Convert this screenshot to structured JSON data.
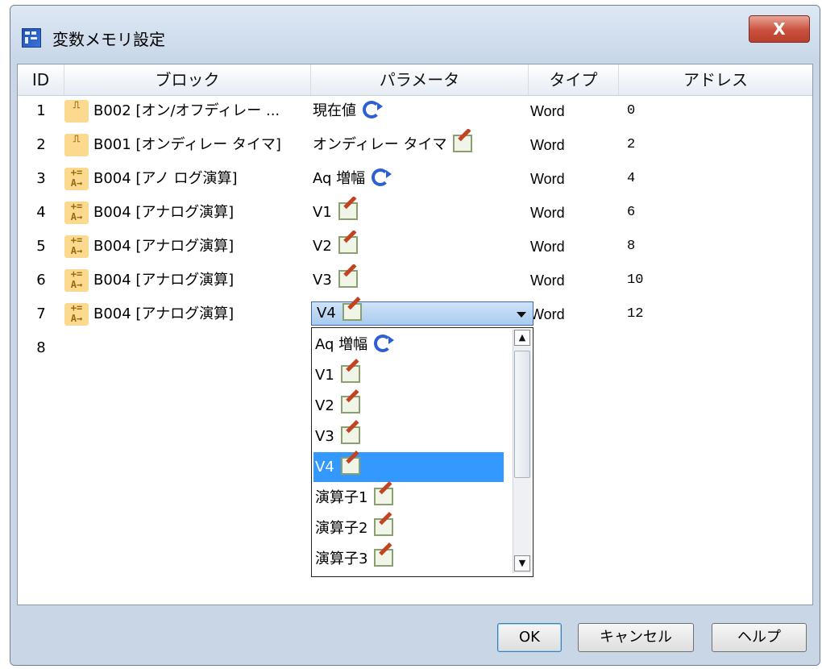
{
  "window": {
    "title": "変数メモリ設定",
    "close_label": "X"
  },
  "table": {
    "headers": {
      "id": "ID",
      "block": "ブロック",
      "param": "パラメータ",
      "type": "タイプ",
      "address": "アドレス"
    },
    "rows": [
      {
        "id": "1",
        "icon": "on-off-delay-icon",
        "icon_glyph": "⎍",
        "block": "B002 [オン/オフディレー ...",
        "param": "現在値",
        "param_icon": "refresh-icon",
        "type": "Word",
        "address": "0"
      },
      {
        "id": "2",
        "icon": "on-delay-icon",
        "icon_glyph": "⎍",
        "block": "B001 [オンディレー タイマ]",
        "param": "オンディレー タイマ",
        "param_icon": "edit-icon",
        "type": "Word",
        "address": "2"
      },
      {
        "id": "3",
        "icon": "analog-math-icon",
        "icon_glyph": "+=\nA→",
        "block": "B004 [アノ ログ演算]",
        "param": "Aq 増幅",
        "param_icon": "refresh-icon",
        "type": "Word",
        "address": "4"
      },
      {
        "id": "4",
        "icon": "analog-math-icon",
        "icon_glyph": "+=\nA→",
        "block": "B004 [アナログ演算]",
        "param": "V1",
        "param_icon": "edit-icon",
        "type": "Word",
        "address": "6"
      },
      {
        "id": "5",
        "icon": "analog-math-icon",
        "icon_glyph": "+=\nA→",
        "block": "B004 [アナログ演算]",
        "param": "V2",
        "param_icon": "edit-icon",
        "type": "Word",
        "address": "8"
      },
      {
        "id": "6",
        "icon": "analog-math-icon",
        "icon_glyph": "+=\nA→",
        "block": "B004 [アナログ演算]",
        "param": "V3",
        "param_icon": "edit-icon",
        "type": "Word",
        "address": "10"
      },
      {
        "id": "7",
        "icon": "analog-math-icon",
        "icon_glyph": "+=\nA→",
        "block": "B004 [アナログ演算]",
        "param": "V4",
        "param_icon": "edit-icon",
        "type": "Word",
        "address": "12"
      },
      {
        "id": "8",
        "icon": "",
        "icon_glyph": "",
        "block": "",
        "param": "",
        "param_icon": "",
        "type": "",
        "address": ""
      }
    ]
  },
  "combo": {
    "selected": "V4",
    "options": [
      {
        "label": "Aq 増幅",
        "icon": "refresh-icon"
      },
      {
        "label": "V1",
        "icon": "edit-icon"
      },
      {
        "label": "V2",
        "icon": "edit-icon"
      },
      {
        "label": "V3",
        "icon": "edit-icon"
      },
      {
        "label": "V4",
        "icon": "edit-icon",
        "selected": true
      },
      {
        "label": "演算子1",
        "icon": "edit-icon"
      },
      {
        "label": "演算子2",
        "icon": "edit-icon"
      },
      {
        "label": "演算子3",
        "icon": "edit-icon"
      }
    ]
  },
  "buttons": {
    "ok": "OK",
    "cancel": "キャンセル",
    "help": "ヘルプ"
  }
}
